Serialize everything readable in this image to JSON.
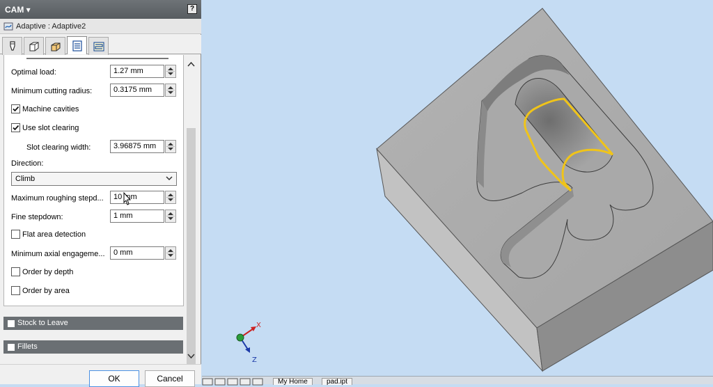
{
  "header": {
    "title": "CAM ▾",
    "help": "?"
  },
  "operation": {
    "title": "Adaptive : Adaptive2"
  },
  "tabs": [
    "tool-tab",
    "geometry-tab",
    "heights-tab",
    "passes-tab",
    "linking-tab"
  ],
  "form": {
    "optimal_load": {
      "label": "Optimal load:",
      "value": "1.27 mm"
    },
    "min_cutting_radius": {
      "label": "Minimum cutting radius:",
      "value": "0.3175 mm"
    },
    "machine_cavities": {
      "label": "Machine cavities",
      "checked": true
    },
    "use_slot_clearing": {
      "label": "Use slot clearing",
      "checked": true
    },
    "slot_clearing_width": {
      "label": "Slot clearing width:",
      "value": "3.96875 mm"
    },
    "direction": {
      "label": "Direction:",
      "value": "Climb"
    },
    "max_roughing_stepdown": {
      "label": "Maximum roughing stepd...",
      "value": "10 mm"
    },
    "fine_stepdown": {
      "label": "Fine stepdown:",
      "value": "1 mm"
    },
    "flat_area_detection": {
      "label": "Flat area detection",
      "checked": false
    },
    "min_axial_engagement": {
      "label": "Minimum axial engageme...",
      "value": "0 mm"
    },
    "order_by_depth": {
      "label": "Order by depth",
      "checked": false
    },
    "order_by_area": {
      "label": "Order by area",
      "checked": false
    }
  },
  "sections": {
    "stock_to_leave": "Stock to Leave",
    "fillets": "Fillets"
  },
  "buttons": {
    "ok": "OK",
    "cancel": "Cancel"
  },
  "triad": {
    "x": "X",
    "z": "Z"
  },
  "bottom_tabs": {
    "my_home": "My Home",
    "part": "pad.ipt"
  },
  "colors": {
    "toolpath": "#f0c419",
    "part": "#a9a9a9",
    "viewport_bg": "#c5dcf3",
    "header_bg": "#5f6468"
  }
}
